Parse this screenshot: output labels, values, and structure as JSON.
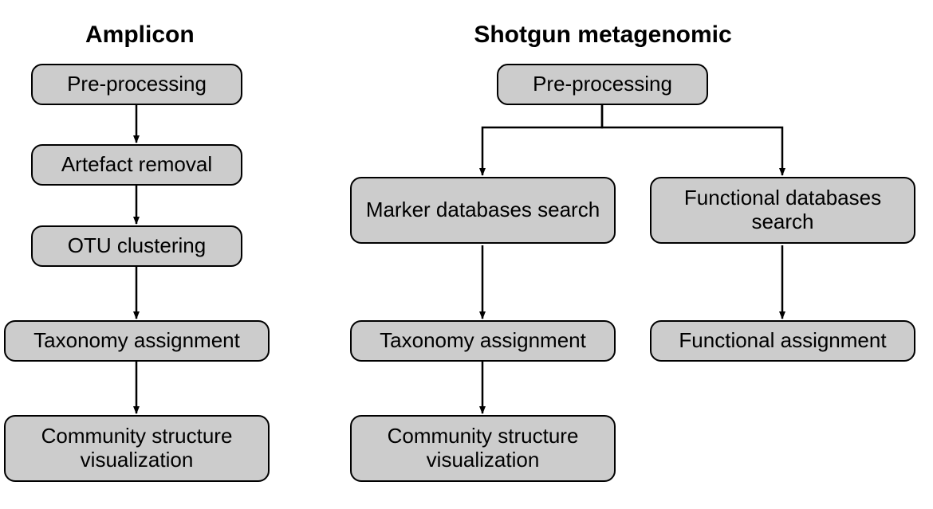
{
  "headings": {
    "amplicon": "Amplicon",
    "shotgun": "Shotgun metagenomic"
  },
  "nodes": {
    "amp_preprocessing": "Pre-processing",
    "amp_artefact": "Artefact removal",
    "amp_otu": "OTU clustering",
    "amp_taxonomy": "Taxonomy assignment",
    "amp_community": "Community structure visualization",
    "sg_preprocessing": "Pre-processing",
    "sg_marker": "Marker databases search",
    "sg_functional_db": "Functional databases search",
    "sg_taxonomy": "Taxonomy assignment",
    "sg_functional_assign": "Functional assignment",
    "sg_community": "Community structure visualization"
  }
}
